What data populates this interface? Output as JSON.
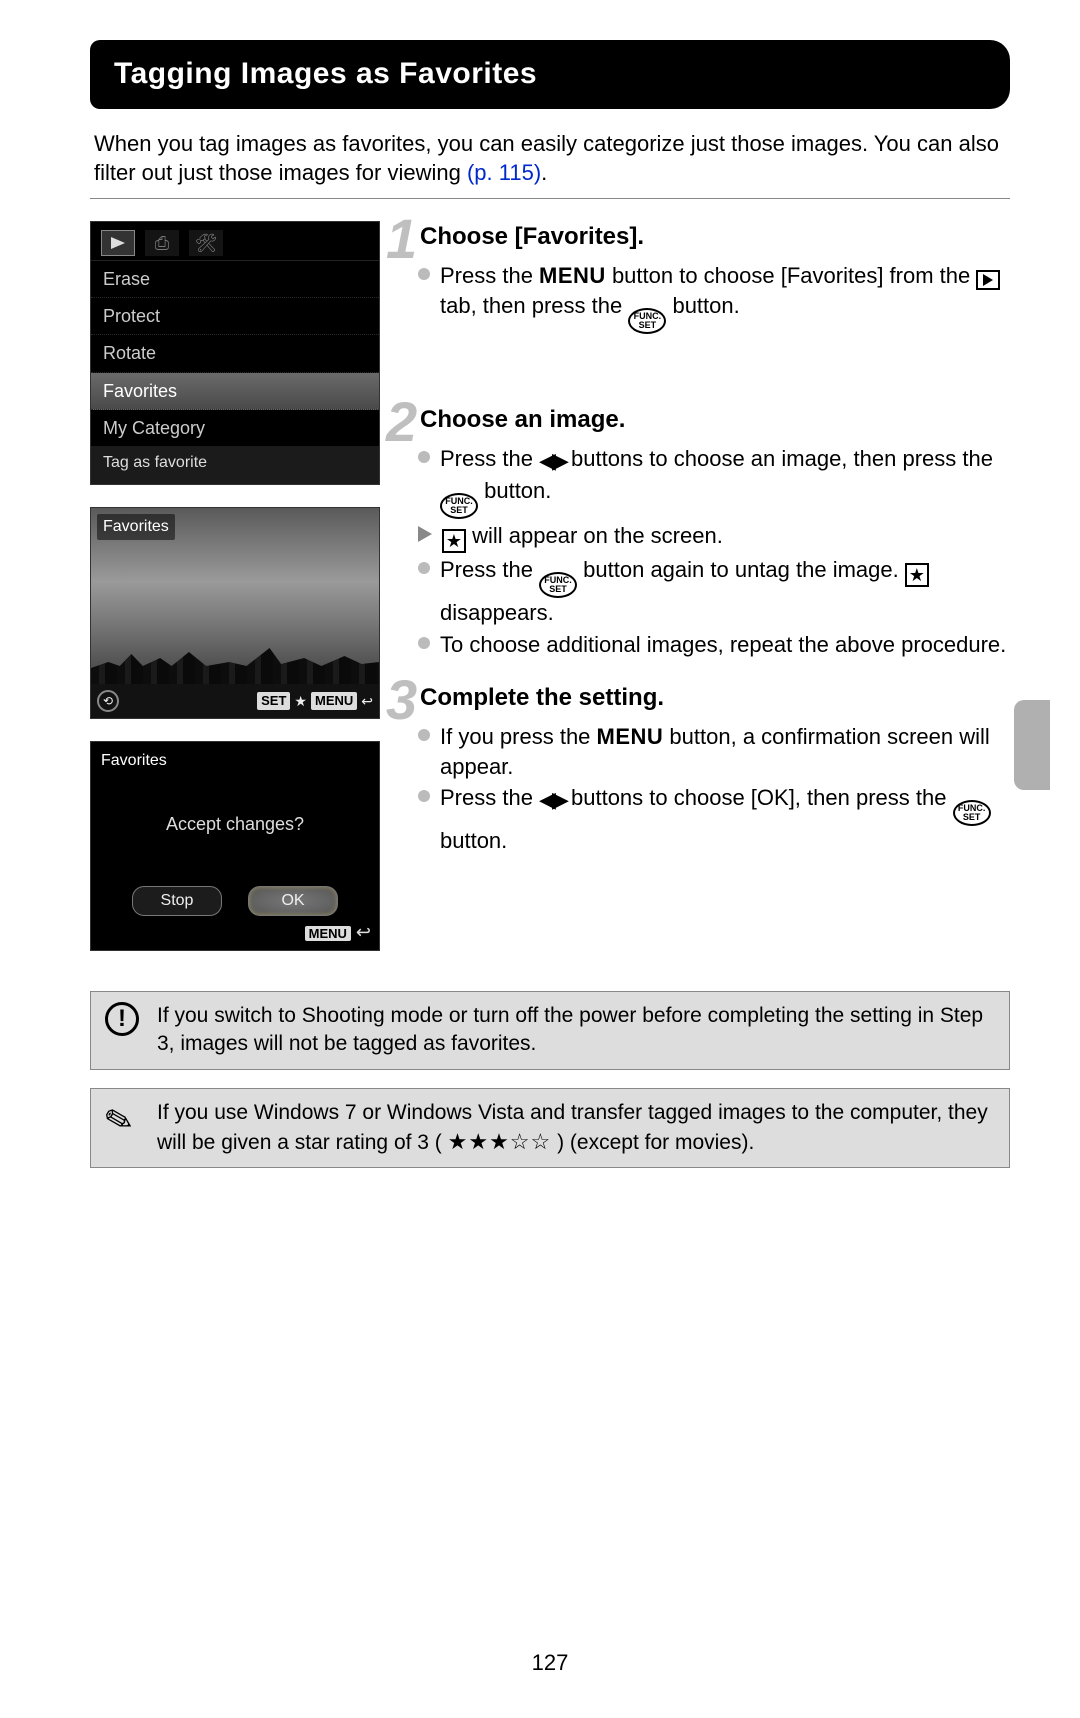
{
  "title": "Tagging Images as Favorites",
  "intro_part1": "When you tag images as favorites, you can easily categorize just those images. You can also filter out just those images for viewing ",
  "intro_link": "(p. 115)",
  "intro_part2": ".",
  "lcd_menu": {
    "items": [
      "Erase",
      "Protect",
      "Rotate",
      "Favorites",
      "My Category"
    ],
    "selected_index": 3,
    "help_text": "Tag as favorite"
  },
  "lcd_photo": {
    "overlay_label": "Favorites",
    "set_label": "SET",
    "menu_label": "MENU"
  },
  "lcd_confirm": {
    "title": "Favorites",
    "message": "Accept changes?",
    "btn_stop": "Stop",
    "btn_ok": "OK",
    "menu_label": "MENU"
  },
  "steps": [
    {
      "num": "1",
      "heading": "Choose [Favorites].",
      "b1a": "Press the ",
      "b1_menu": "MENU",
      "b1b": " button to choose [Favorites] from the ",
      "b1c": " tab, then press the ",
      "b1d": " button."
    },
    {
      "num": "2",
      "heading": "Choose an image.",
      "b1a": "Press the ",
      "b1b": " buttons to choose an image, then press the ",
      "b1c": " button.",
      "b2a": " will appear on the screen.",
      "b3a": "Press the ",
      "b3b": " button again to untag the image. ",
      "b3c": " disappears.",
      "b4": "To choose additional images, repeat the above procedure."
    },
    {
      "num": "3",
      "heading": "Complete the setting.",
      "b1a": "If you press the ",
      "b1_menu": "MENU",
      "b1b": " button, a confirmation screen will appear.",
      "b2a": "Press the ",
      "b2b": " buttons to choose [OK], then press the ",
      "b2c": " button."
    }
  ],
  "note1": "If you switch to Shooting mode or turn off the power before completing the setting in Step 3, images will not be tagged as favorites.",
  "note2a": "If you use Windows 7 or Windows Vista and transfer tagged images to the computer, they will be given a star rating of 3 ( ",
  "note2_stars": "★★★☆☆",
  "note2b": " ) (except for movies).",
  "page_number": "127"
}
